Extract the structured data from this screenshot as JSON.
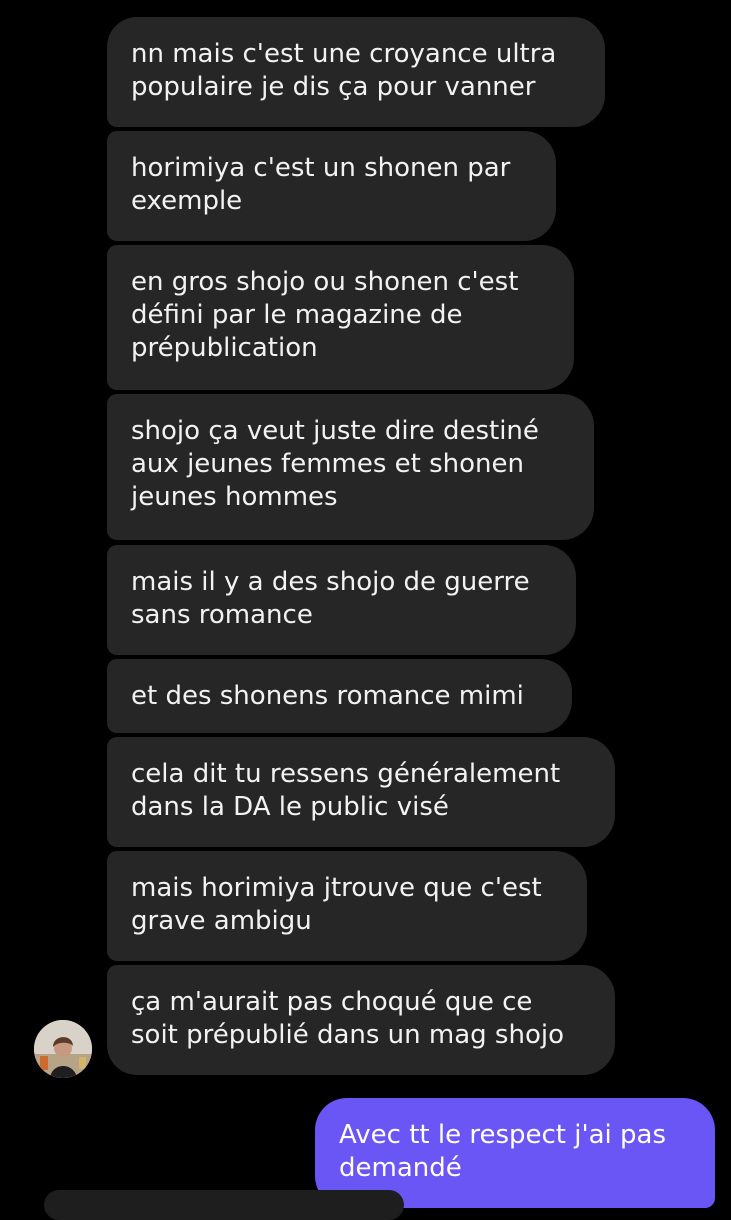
{
  "messages": [
    {
      "lines": [
        "nn mais c'est une croyance ultra",
        "populaire je dis ça pour vanner"
      ]
    },
    {
      "lines": [
        "horimiya c'est un shonen par",
        "exemple"
      ]
    },
    {
      "lines": [
        "en gros shojo ou shonen c'est",
        "défini par le magazine de",
        "prépublication"
      ]
    },
    {
      "lines": [
        "shojo ça veut juste dire destiné",
        "aux jeunes femmes et shonen",
        "jeunes hommes"
      ]
    },
    {
      "lines": [
        "mais il y a des shojo de guerre",
        "sans romance"
      ]
    },
    {
      "lines": [
        "et des shonens romance mimi"
      ]
    },
    {
      "lines": [
        "cela dit tu ressens généralement",
        "dans la DA le public visé"
      ]
    },
    {
      "lines": [
        "mais horimiya jtrouve que c'est",
        "grave ambigu"
      ]
    },
    {
      "lines": [
        "ça m'aurait pas choqué que ce",
        "soit prépublié dans un mag shojo"
      ]
    }
  ],
  "reply": {
    "lines": [
      "Avec tt le respect j'ai pas",
      "demandé"
    ]
  },
  "colors": {
    "background": "#000000",
    "incoming_bubble": "#262626",
    "outgoing_bubble": "#6a55f5",
    "text": "#f2f2f2"
  }
}
